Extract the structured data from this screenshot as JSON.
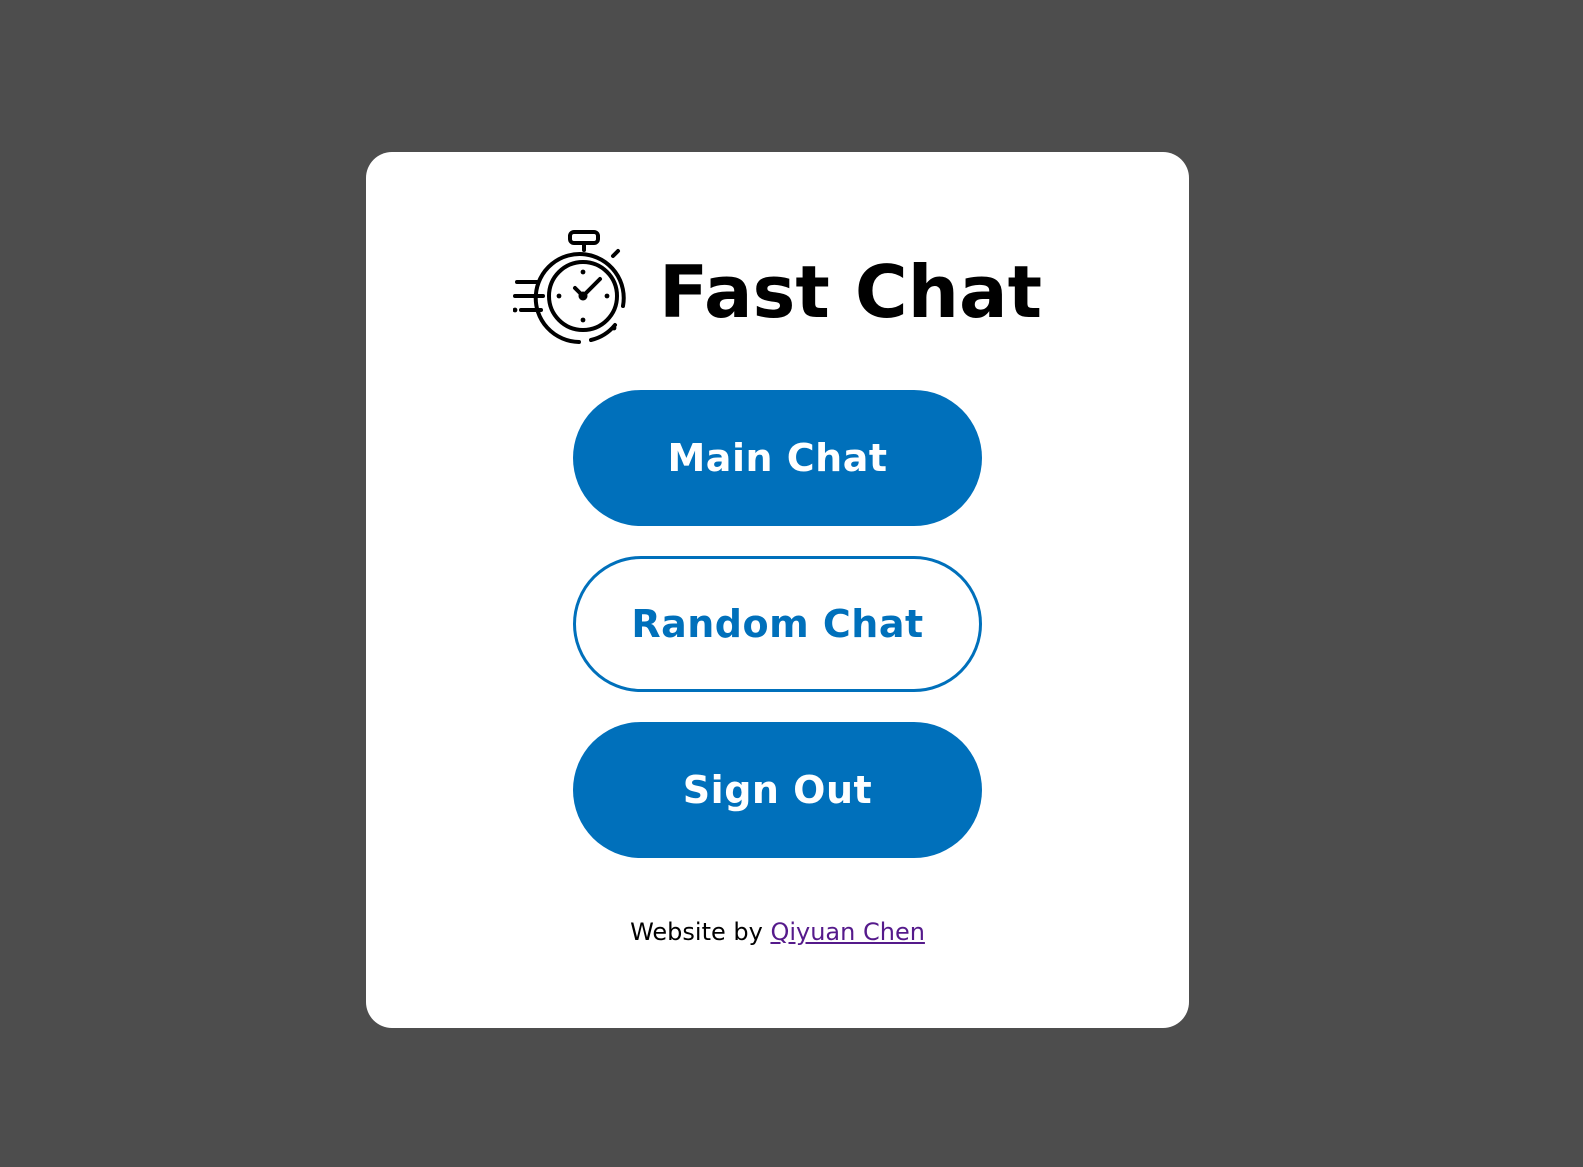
{
  "app": {
    "title": "Fast Chat",
    "logo_icon": "stopwatch-icon"
  },
  "buttons": {
    "main_chat": "Main Chat",
    "random_chat": "Random Chat",
    "sign_out": "Sign Out"
  },
  "footer": {
    "prefix": "Website by",
    "author_link": "Qiyuan Chen"
  },
  "colors": {
    "background": "#4d4d4d",
    "card": "#ffffff",
    "accent": "#0070bb",
    "visited_link": "#551a8b"
  }
}
